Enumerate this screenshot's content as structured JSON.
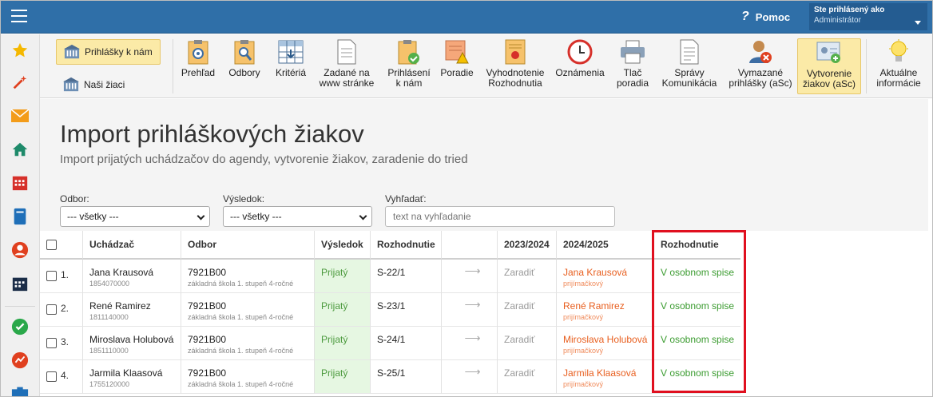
{
  "topbar": {
    "help_label": "Pomoc",
    "user_line1": "Ste prihlásený ako",
    "user_line2": "Administrátor"
  },
  "ribbon": {
    "left": {
      "apps_label": "Prihlášky k nám",
      "students_label": "Naši žiaci"
    },
    "tools": [
      {
        "label": "Prehľad"
      },
      {
        "label": "Odbory"
      },
      {
        "label": "Kritériá"
      },
      {
        "label": "Zadané na\nwww stránke"
      },
      {
        "label": "Prihlásení\nk nám"
      },
      {
        "label": "Poradie"
      },
      {
        "label": "Vyhodnotenie\nRozhodnutia"
      },
      {
        "label": "Oznámenia"
      },
      {
        "label": "Tlač\nporadia"
      },
      {
        "label": "Správy\nKomunikácia"
      },
      {
        "label": "Vymazané\nprihlášky (aSc)"
      },
      {
        "label": "Vytvorenie\nžiakov (aSc)"
      },
      {
        "label": "Aktuálne\ninformácie"
      }
    ]
  },
  "page": {
    "title": "Import prihláškových žiakov",
    "subtitle": "Import prijatých uchádzačov do agendy, vytvorenie žiakov, zaradenie do tried"
  },
  "filters": {
    "odbor_label": "Odbor:",
    "odbor_value": "--- všetky ---",
    "vysledok_label": "Výsledok:",
    "vysledok_value": "--- všetky ---",
    "search_label": "Vyhľadať:",
    "search_placeholder": "text na vyhľadanie"
  },
  "table": {
    "columns": [
      "Uchádzač",
      "Odbor",
      "Výsledok",
      "Rozhodnutie",
      "2023/2024",
      "2024/2025",
      "Rozhodnutie"
    ],
    "rows": [
      {
        "num": "1.",
        "name": "Jana Krausová",
        "code": "1854070000",
        "odbor": "7921B00",
        "odbor_desc": "základná škola 1. stupeň 4-ročné",
        "vysledok": "Prijatý",
        "rozhodnutie": "S-22/1",
        "arrow": "⟶",
        "y2023": "Zaradiť",
        "y2024_name": "Jana Krausová",
        "y2024_sub": "prijímačkový",
        "status": "V osobnom spise"
      },
      {
        "num": "2.",
        "name": "René Ramirez",
        "code": "1811140000",
        "odbor": "7921B00",
        "odbor_desc": "základná škola 1. stupeň 4-ročné",
        "vysledok": "Prijatý",
        "rozhodnutie": "S-23/1",
        "arrow": "⟶",
        "y2023": "Zaradiť",
        "y2024_name": "René Ramirez",
        "y2024_sub": "prijímačkový",
        "status": "V osobnom spise"
      },
      {
        "num": "3.",
        "name": "Miroslava Holubová",
        "code": "1851110000",
        "odbor": "7921B00",
        "odbor_desc": "základná škola 1. stupeň 4-ročné",
        "vysledok": "Prijatý",
        "rozhodnutie": "S-24/1",
        "arrow": "⟶",
        "y2023": "Zaradiť",
        "y2024_name": "Miroslava Holubová",
        "y2024_sub": "prijímačkový",
        "status": "V osobnom spise"
      },
      {
        "num": "4.",
        "name": "Jarmila Klaasová",
        "code": "1755120000",
        "odbor": "7921B00",
        "odbor_desc": "základná škola 1. stupeň 4-ročné",
        "vysledok": "Prijatý",
        "rozhodnutie": "S-25/1",
        "arrow": "⟶",
        "y2023": "Zaradiť",
        "y2024_name": "Jarmila Klaasová",
        "y2024_sub": "prijímačkový",
        "status": "V osobnom spise"
      }
    ]
  },
  "colors": {
    "topbar": "#2f6fa8",
    "highlight": "#fbeaa7",
    "accepted_bg": "#e6f7e2",
    "status_green": "#3a9b2f",
    "orange": "#e85f1f",
    "red_outline": "#e0101f"
  },
  "icons": {
    "rail": [
      "star-icon",
      "magic-wand-icon",
      "envelope-icon",
      "home-icon",
      "calendar-icon",
      "notebook-icon",
      "person-icon",
      "timetable-icon",
      "check-circle-icon",
      "chart-circle-icon",
      "briefcase-icon"
    ]
  }
}
